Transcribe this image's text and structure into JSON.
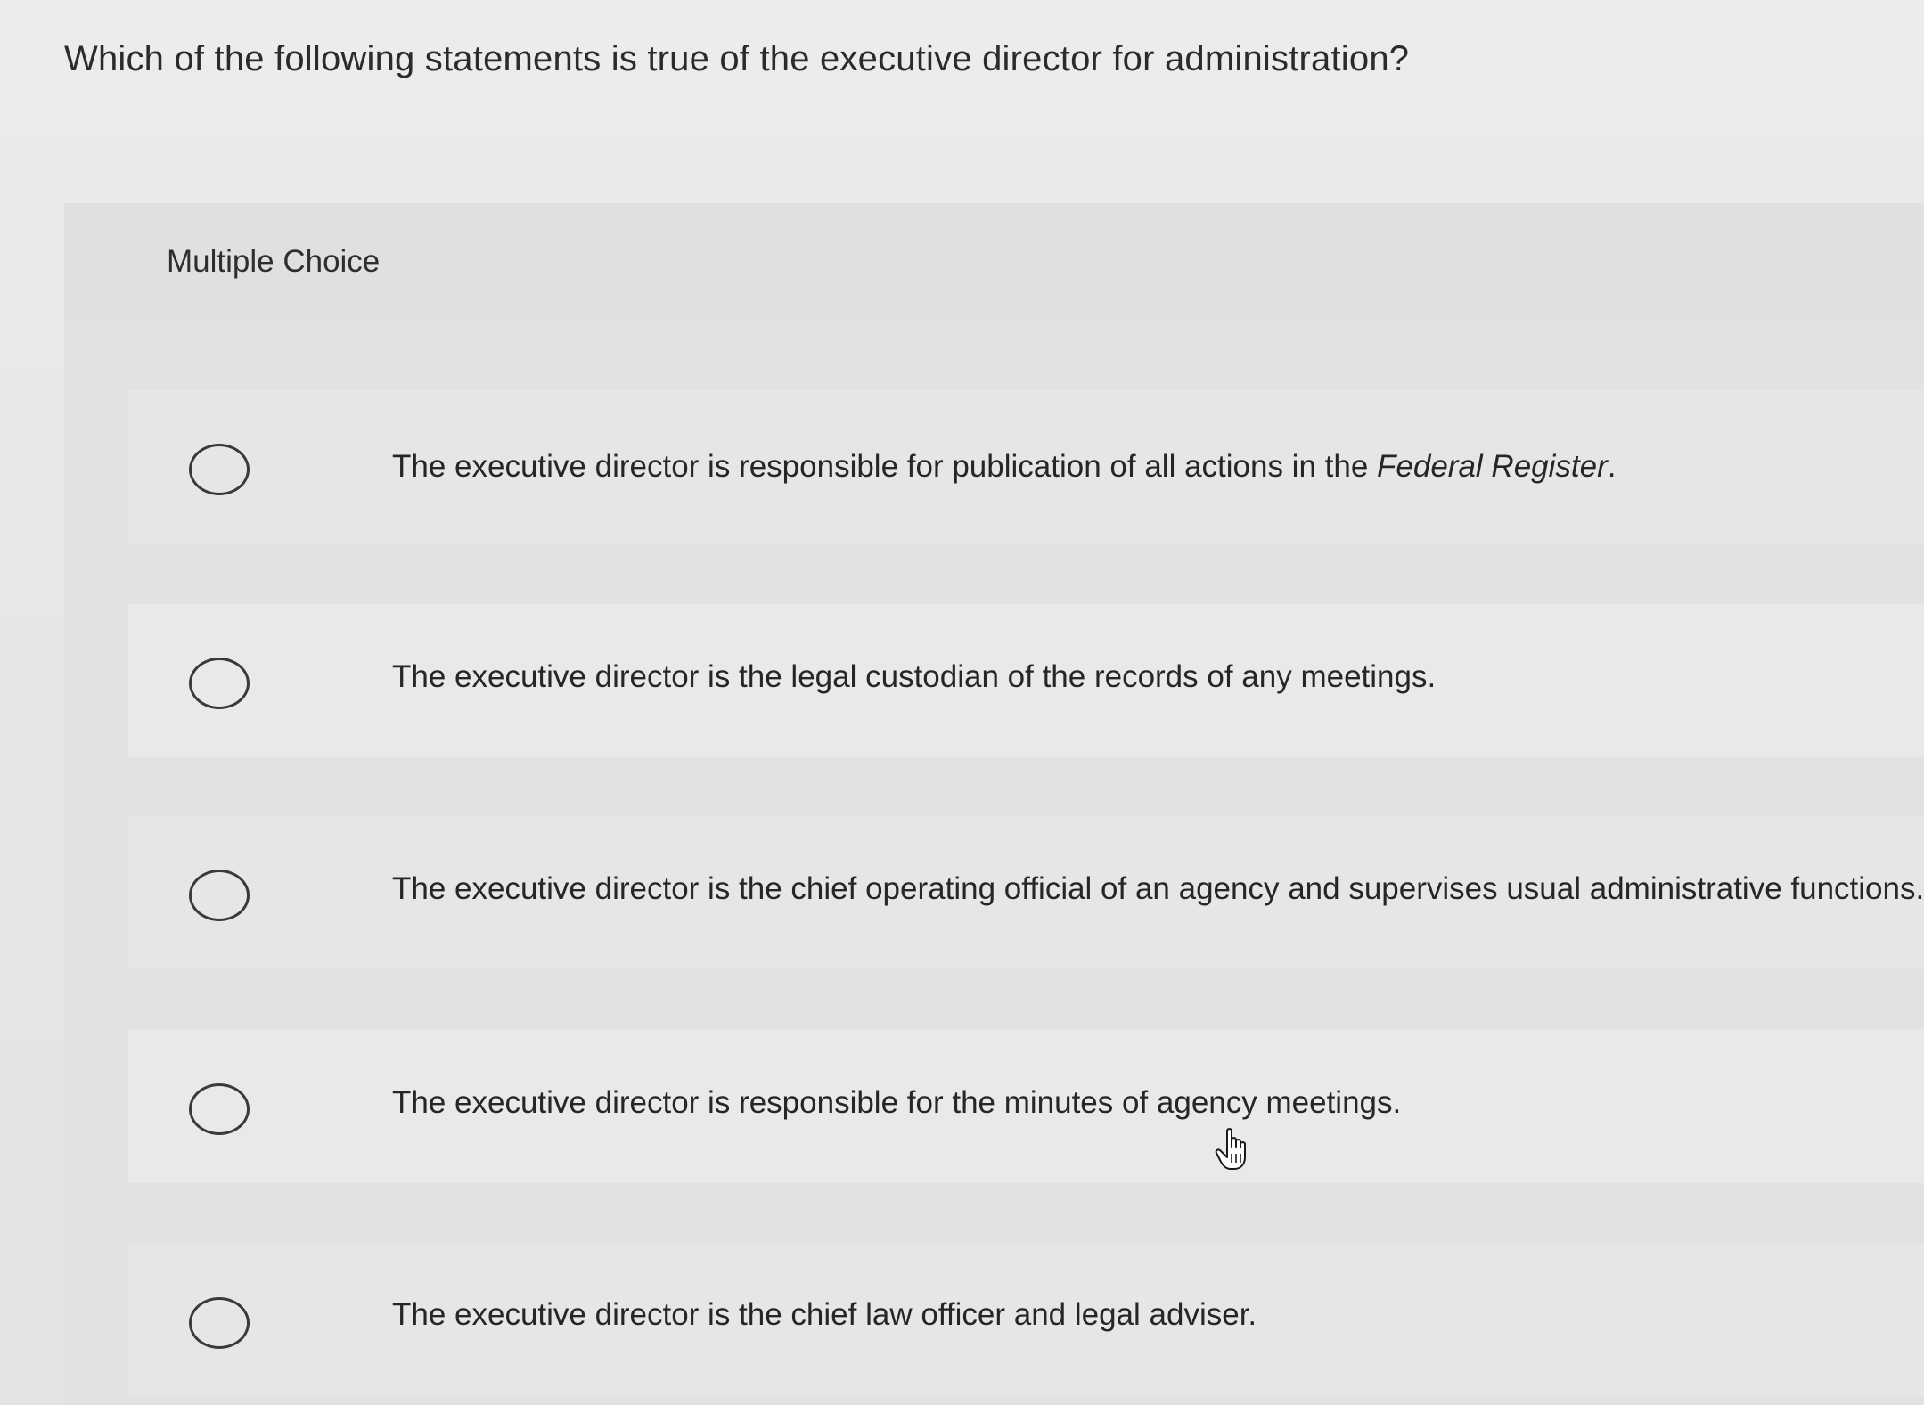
{
  "question": {
    "text": "Which of the following statements is true of the executive director for administration?"
  },
  "panel": {
    "header_label": "Multiple Choice"
  },
  "options": [
    {
      "text_before": "The executive director is responsible for publication of all actions in the ",
      "text_italic": "Federal Register",
      "text_after": "."
    },
    {
      "text_before": "The executive director is the legal custodian of the records of any meetings.",
      "text_italic": "",
      "text_after": ""
    },
    {
      "text_before": "The executive director is the chief operating official of an agency and supervises usual administrative functions.",
      "text_italic": "",
      "text_after": ""
    },
    {
      "text_before": "The executive director is responsible for the minutes of agency meetings.",
      "text_italic": "",
      "text_after": ""
    },
    {
      "text_before": "The executive director is the chief law officer and legal adviser.",
      "text_italic": "",
      "text_after": ""
    }
  ],
  "cursor": {
    "icon": "hand-pointer-icon"
  }
}
